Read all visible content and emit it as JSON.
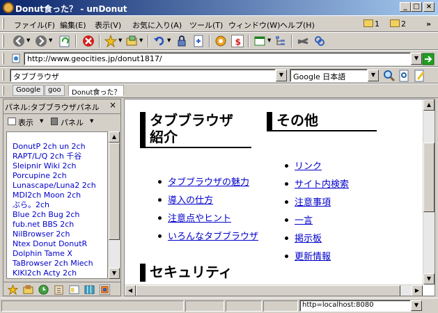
{
  "window": {
    "title": "Donut食った？ - unDonut"
  },
  "menu": [
    "ファイル(F)",
    "編集(E)",
    "表示(V)",
    "お気に入り(A)",
    "ツール(T)",
    "ウィンドウ(W)",
    "ヘルプ(H)"
  ],
  "window_tabs": [
    "1",
    "2"
  ],
  "address": {
    "url": "http://www.geocities.jp/donut1817/"
  },
  "search": {
    "query": "タブブラウザ",
    "engine": "Google 日本語"
  },
  "tabs": [
    "Google",
    "goo",
    "Donut食った？"
  ],
  "panel": {
    "title": "パネル:タブブラウザパネル",
    "view_label": "表示",
    "panel_label": "パネル",
    "items": [
      "DonutP 2ch un 2ch",
      "RAPT/L/Q 2ch 千谷",
      "Sleipnir Wiki 2ch",
      "Porcupine 2ch",
      "Lunascape/Luna2 2ch",
      "MDI2ch Moon 2ch",
      "ぶら。2ch",
      "Blue 2ch Bug 2ch",
      "fub.net BBS 2ch",
      "NilBrowser 2ch",
      "Ntex Donut DonutR",
      "Dolphin Tame X",
      "TaBrowser 2ch Miech",
      "KIKI2ch Acty 2ch"
    ]
  },
  "content": {
    "section1_title_line1": "タブブラウザ",
    "section1_title_line2": "紹介",
    "section1_links": [
      "タブブラウザの魅力",
      "導入の仕方",
      "注意点やヒント",
      "いろんなタブブラウザ"
    ],
    "section2_title": "その他",
    "section2_links": [
      "リンク",
      "サイト内検索",
      "注意事項",
      "一言",
      "掲示板",
      "更新情報"
    ],
    "section3_title": "セキュリティ"
  },
  "status": {
    "proxy": "http=localhost:8080"
  }
}
